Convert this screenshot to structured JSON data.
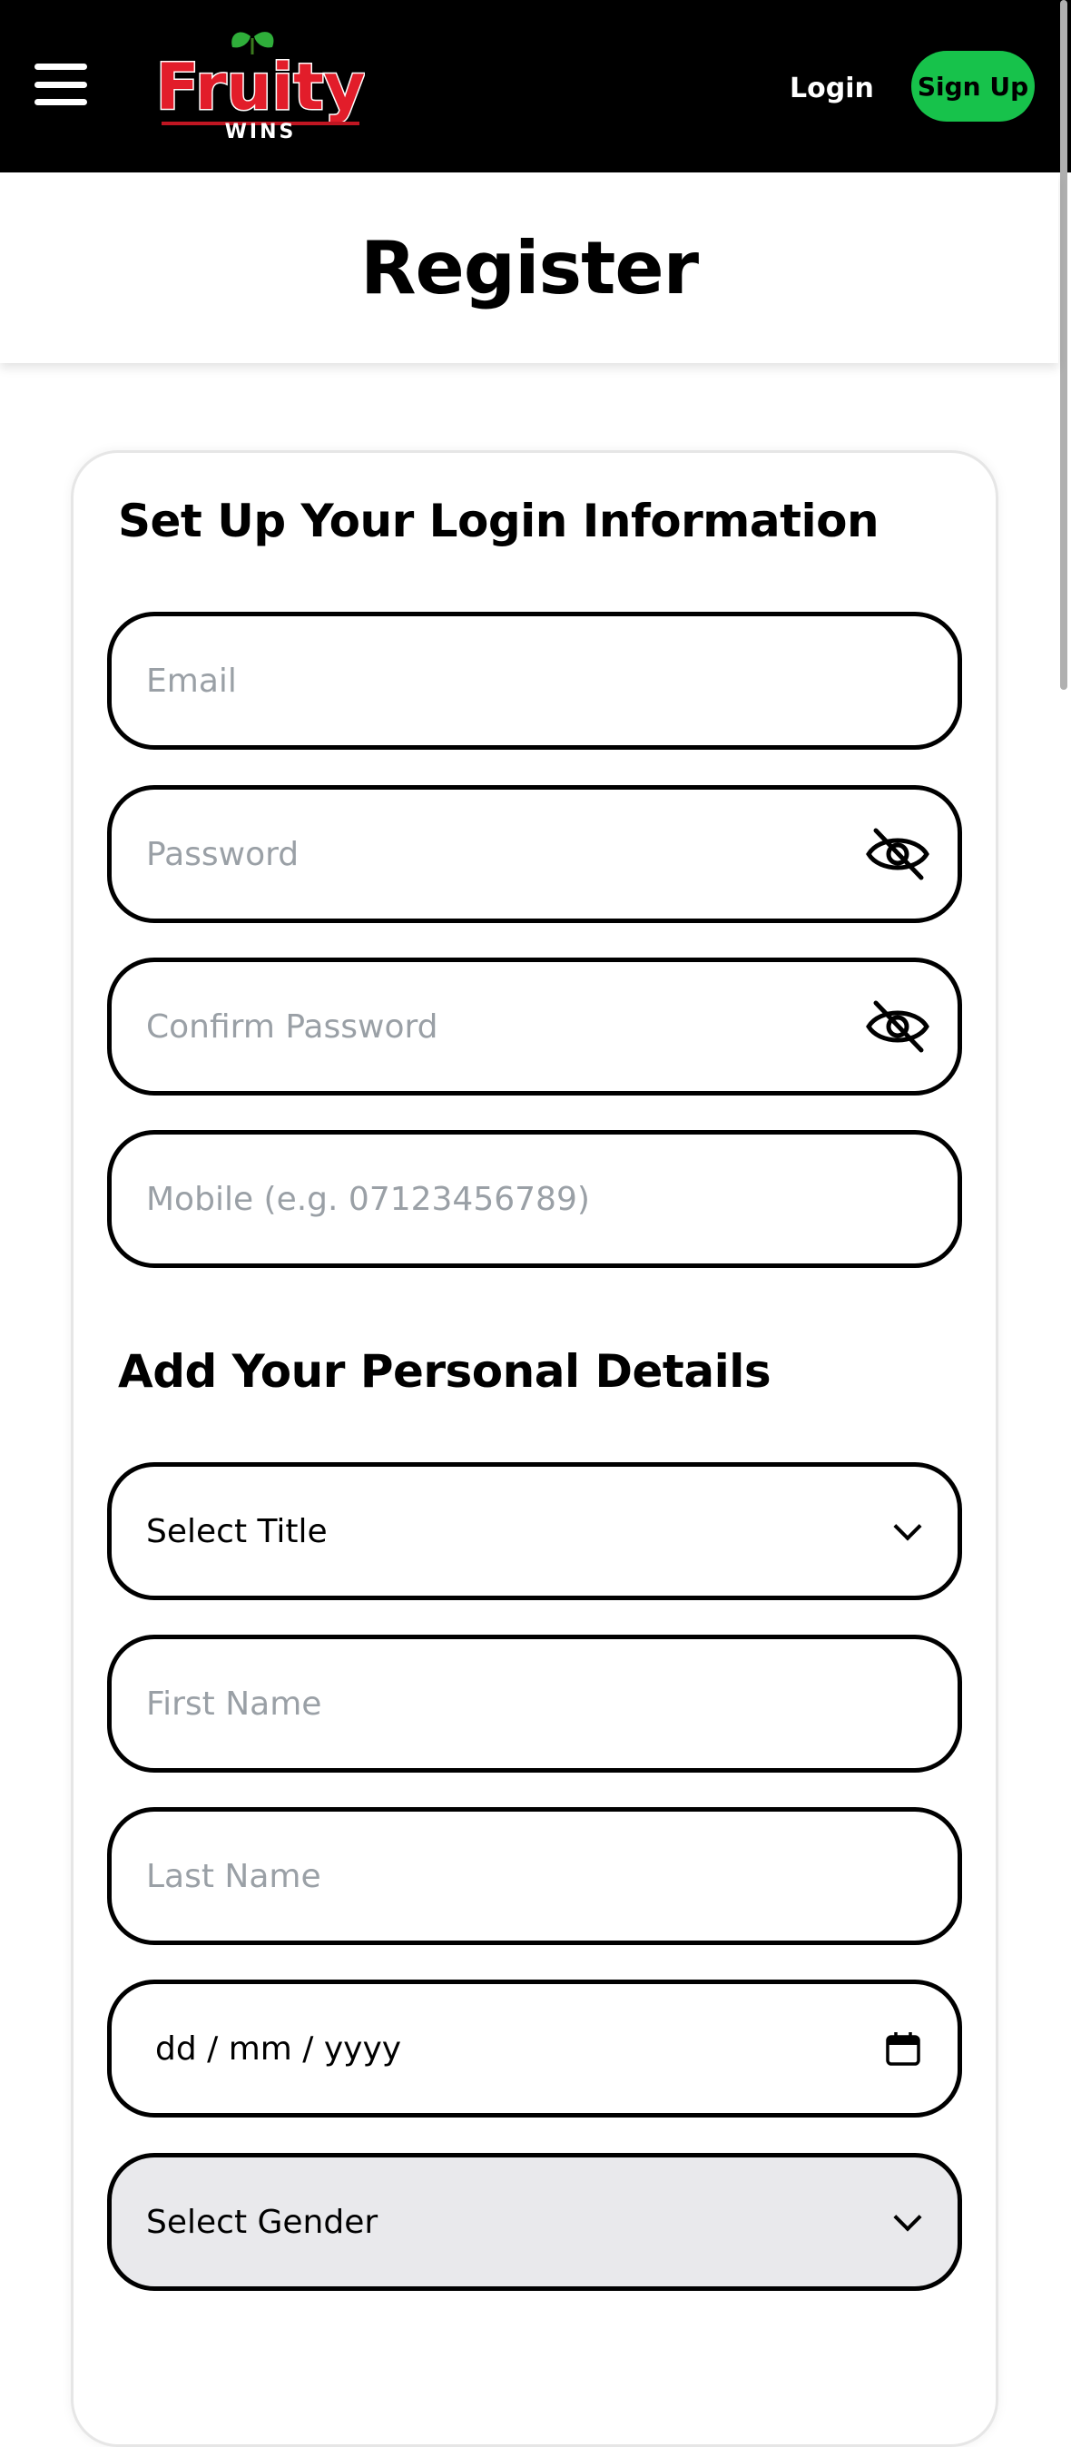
{
  "header": {
    "logo_text": "Fruity",
    "logo_subtext": "WINS",
    "login_label": "Login",
    "signup_label": "Sign Up"
  },
  "page_title": "Register",
  "login_section": {
    "heading": "Set Up Your Login Information",
    "email_placeholder": "Email",
    "password_placeholder": "Password",
    "confirm_password_placeholder": "Confirm Password",
    "mobile_placeholder": "Mobile (e.g. 07123456789)"
  },
  "personal_section": {
    "heading": "Add Your Personal Details",
    "title_select": "Select Title",
    "first_name_placeholder": "First Name",
    "last_name_placeholder": "Last Name",
    "dob_placeholder": "dd / mm / yyyy",
    "gender_select": "Select Gender"
  },
  "colors": {
    "header_bg": "#000000",
    "accent_green": "#17c24b",
    "logo_red": "#e21d2a",
    "placeholder_gray": "#9aa0a6"
  },
  "icons": [
    "hamburger-menu-icon",
    "eye-off-icon",
    "calendar-icon",
    "chevron-down-icon"
  ]
}
